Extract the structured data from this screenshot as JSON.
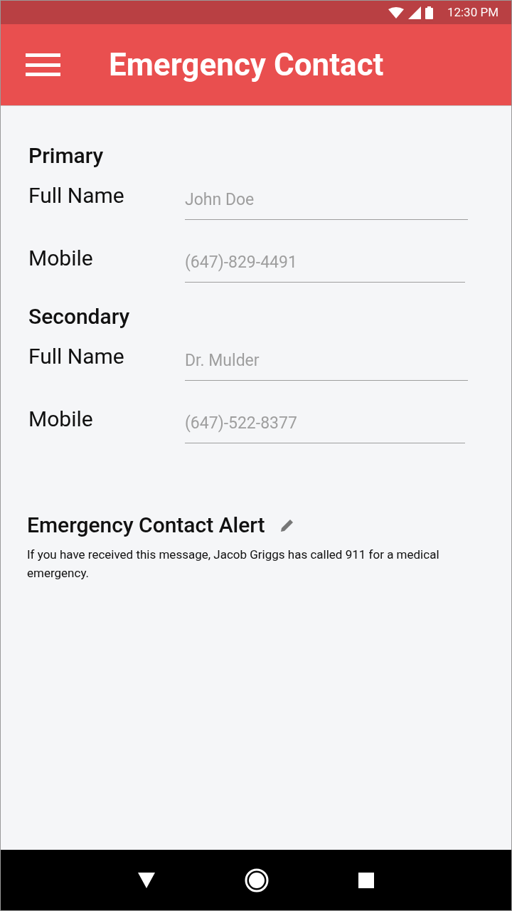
{
  "status_bar": {
    "time": "12:30 PM"
  },
  "app_bar": {
    "title": "Emergency Contact"
  },
  "sections": [
    {
      "heading": "Primary",
      "fields": [
        {
          "label": "Full Name",
          "placeholder": "John Doe"
        },
        {
          "label": "Mobile",
          "placeholder": "(647)-829-4491"
        }
      ]
    },
    {
      "heading": "Secondary",
      "fields": [
        {
          "label": "Full Name",
          "placeholder": "Dr. Mulder"
        },
        {
          "label": "Mobile",
          "placeholder": "(647)-522-8377"
        }
      ]
    }
  ],
  "alert": {
    "title": "Emergency Contact Alert",
    "message": "If you have received this message, Jacob Griggs has called 911 for a medical emergency."
  }
}
